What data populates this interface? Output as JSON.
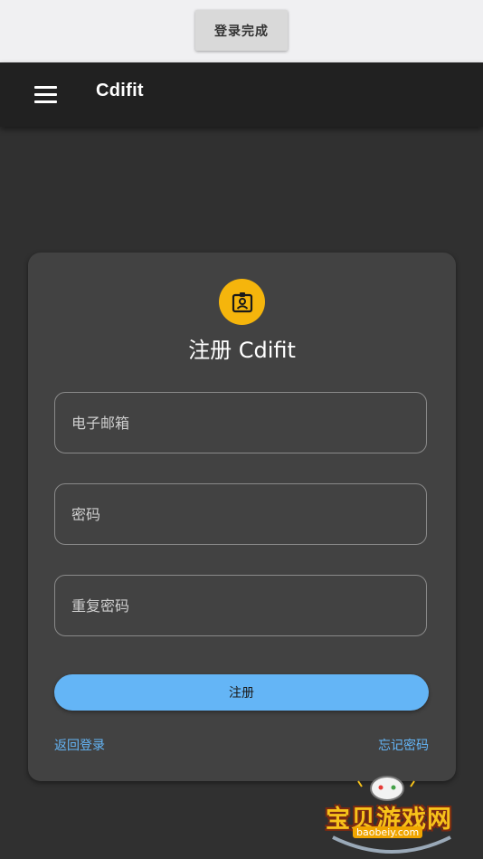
{
  "top_strip": {
    "done_button_label": "登录完成"
  },
  "app_bar": {
    "title": "Cdifit",
    "menu_icon": "menu-icon"
  },
  "register_card": {
    "icon": "contact-badge-icon",
    "icon_bg_color": "#f5b50c",
    "title": "注册 Cdifit",
    "fields": [
      {
        "placeholder": "电子邮箱",
        "value": ""
      },
      {
        "placeholder": "密码",
        "value": ""
      },
      {
        "placeholder": "重复密码",
        "value": ""
      }
    ],
    "submit_label": "注册",
    "submit_color": "#64b5f6",
    "back_to_login": "返回登录",
    "forgot_password": "忘记密码"
  },
  "watermark": {
    "text": "宝贝游戏网",
    "url": "baobeiy.com",
    "icon": "gamepad-icon"
  }
}
